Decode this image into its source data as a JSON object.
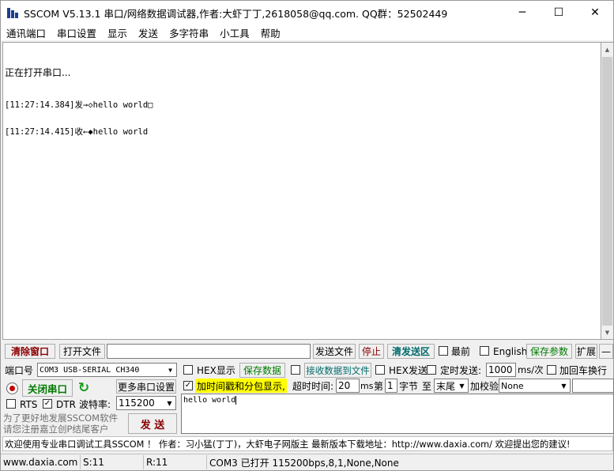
{
  "window": {
    "title": "SSCOM V5.13.1 串口/网络数据调试器,作者:大虾丁丁,2618058@qq.com. QQ群：52502449",
    "minimize_glyph": "─",
    "maximize_glyph": "☐",
    "close_glyph": "✕"
  },
  "menu": [
    "通讯端口",
    "串口设置",
    "显示",
    "发送",
    "多字符串",
    "小工具",
    "帮助"
  ],
  "receive": {
    "status": "正在打开串口...",
    "lines": [
      "[11:27:14.384]发→◇hello world□",
      "[11:27:14.415]收←◆hello world"
    ]
  },
  "toolbar1": {
    "clear_window": "清除窗口",
    "open_file": "打开文件",
    "file_path": "",
    "send_file": "发送文件",
    "stop": "停止",
    "clear_send": "清发送区",
    "topmost": "最前",
    "english": "English",
    "save_params": "保存参数",
    "expand": "扩展",
    "collapse": "—"
  },
  "port": {
    "label": "端口号",
    "selected": "COM3 USB-SERIAL CH340",
    "close_port": "关闭串口",
    "more_settings": "更多串口设置",
    "rts": "RTS",
    "dtr": "DTR",
    "dtr_check": "✓",
    "baud_label": "波特率:",
    "baud": "115200",
    "promo1": "为了更好地发展SSCOM软件",
    "promo2": "请您注册嘉立创P结尾客户",
    "send": "发 送"
  },
  "options": {
    "hex_display": "HEX显示",
    "save_data": "保存数据",
    "recv_to_file": "接收数据到文件",
    "hex_send": "HEX发送",
    "timed_send": "定时发送:",
    "interval": "1000",
    "interval_unit": "ms/次",
    "add_crlf": "加回车换行",
    "timestamp_check": "✓",
    "timestamp": "加时间戳和分包显示,",
    "timeout_label": "超时时间:",
    "timeout": "20",
    "timeout_unit": "ms",
    "nth_label": "第",
    "nth": "1",
    "byte_label": "字节",
    "to_label": "至",
    "end_value": "末尾",
    "checksum_label": "加校验",
    "checksum": "None"
  },
  "send_text": "hello world",
  "banner": "欢迎使用专业串口调试工具SSCOM ！  作者：习小猛(丁丁)，大虾电子网版主  最新版本下载地址：http://www.daxia.com/ 欢迎提出您的建议!",
  "statusbar": {
    "site": "www.daxia.com",
    "sent": "S:11",
    "received": "R:11",
    "port_status": "COM3 已打开  115200bps,8,1,None,None"
  }
}
